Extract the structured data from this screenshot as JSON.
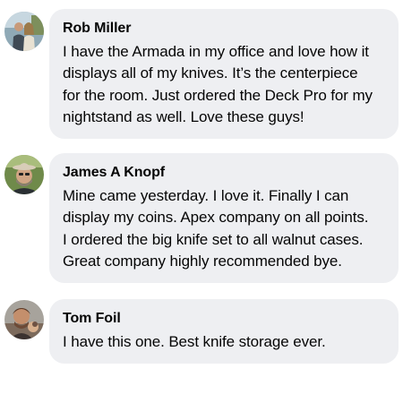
{
  "comments": [
    {
      "author": "Rob Miller",
      "lines": [
        "I have the Armada in my office and love how it",
        "displays all of my knives. It’s the centerpiece",
        "for the room. Just ordered the Deck Pro for my",
        "nightstand as well. Love these guys!"
      ]
    },
    {
      "author": "James A Knopf",
      "lines": [
        "Mine came yesterday. I love it. Finally I can",
        "display my coins. Apex company on all points.",
        "I ordered the big knife set to all walnut cases.",
        "Great company highly recommended bye."
      ]
    },
    {
      "author": "Tom Foil",
      "lines": [
        "I have this one. Best knife storage ever."
      ]
    }
  ],
  "colors": {
    "bubble": "#eeeff2",
    "text": "#050505"
  }
}
